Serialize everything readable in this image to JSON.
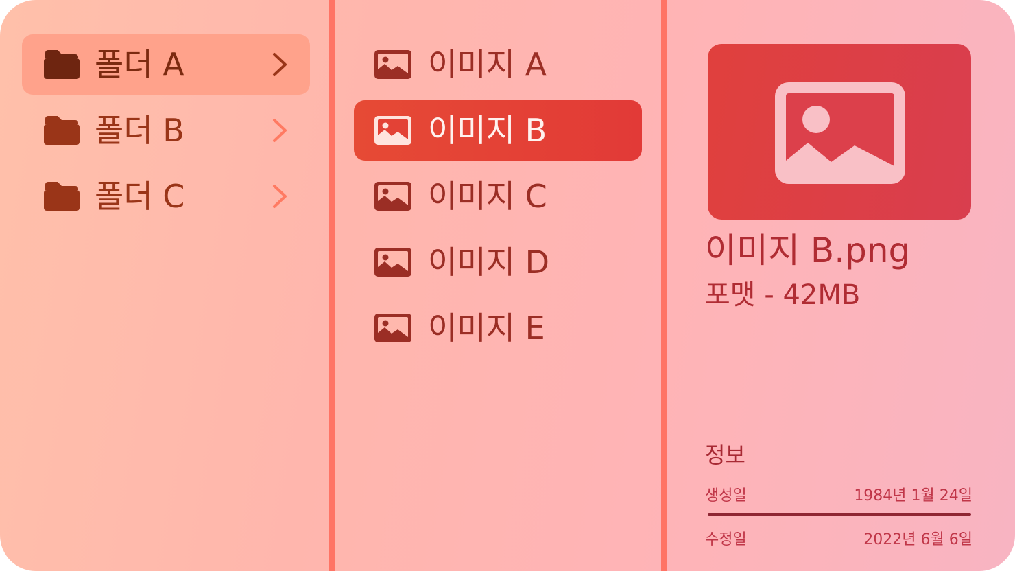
{
  "folders": [
    {
      "label": "폴더 A",
      "selected": true
    },
    {
      "label": "폴더 B",
      "selected": false
    },
    {
      "label": "폴더 C",
      "selected": false
    }
  ],
  "images": [
    {
      "label": "이미지 A",
      "selected": false
    },
    {
      "label": "이미지 B",
      "selected": true
    },
    {
      "label": "이미지 C",
      "selected": false
    },
    {
      "label": "이미지 D",
      "selected": false
    },
    {
      "label": "이미지 E",
      "selected": false
    }
  ],
  "detail": {
    "filename": "이미지 B.png",
    "meta": "포맷 - 42MB",
    "info_title": "정보",
    "created_label": "생성일",
    "created_value": "1984년 1월 24일",
    "modified_label": "수정일",
    "modified_value": "2022년 6월 6일"
  },
  "icons": {
    "folder": "folder-icon",
    "chevron": "chevron-right-icon",
    "image": "image-icon"
  },
  "colors": {
    "accent": "#e3413a",
    "divider": "#ff7465",
    "folder_text": "#9a3518",
    "image_text": "#9b2e25"
  }
}
